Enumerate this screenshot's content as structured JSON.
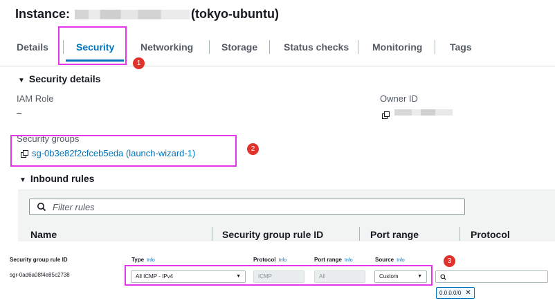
{
  "header": {
    "title_prefix": "Instance:",
    "title_suffix": "(tokyo-ubuntu)"
  },
  "tabs": [
    {
      "label": "Details"
    },
    {
      "label": "Security"
    },
    {
      "label": "Networking"
    },
    {
      "label": "Storage"
    },
    {
      "label": "Status checks"
    },
    {
      "label": "Monitoring"
    },
    {
      "label": "Tags"
    }
  ],
  "security_details": {
    "heading": "Security details",
    "iam_role_label": "IAM Role",
    "iam_role_value": "–",
    "owner_id_label": "Owner ID",
    "security_groups_label": "Security groups",
    "security_group_link": "sg-0b3e82f2cfceb5eda (launch-wizard-1)"
  },
  "inbound_rules": {
    "heading": "Inbound rules",
    "filter_placeholder": "Filter rules",
    "columns": [
      "Name",
      "Security group rule ID",
      "Port range",
      "Protocol"
    ]
  },
  "edit_rule": {
    "headers": {
      "rule_id": "Security group rule ID",
      "type": "Type",
      "protocol": "Protocol",
      "port_range": "Port range",
      "source": "Source",
      "info": "Info"
    },
    "rule_id_value": "sgr-0ad6a08f4e85c2738",
    "type_value": "All ICMP - IPv4",
    "protocol_value": "ICMP",
    "port_range_value": "All",
    "source_value": "Custom",
    "cidr_chip": "0.0.0.0/0"
  },
  "callouts": [
    "1",
    "2",
    "3"
  ],
  "colors": {
    "accent": "#0073bb",
    "highlight": "#e535e8",
    "badge": "#e0332b"
  }
}
